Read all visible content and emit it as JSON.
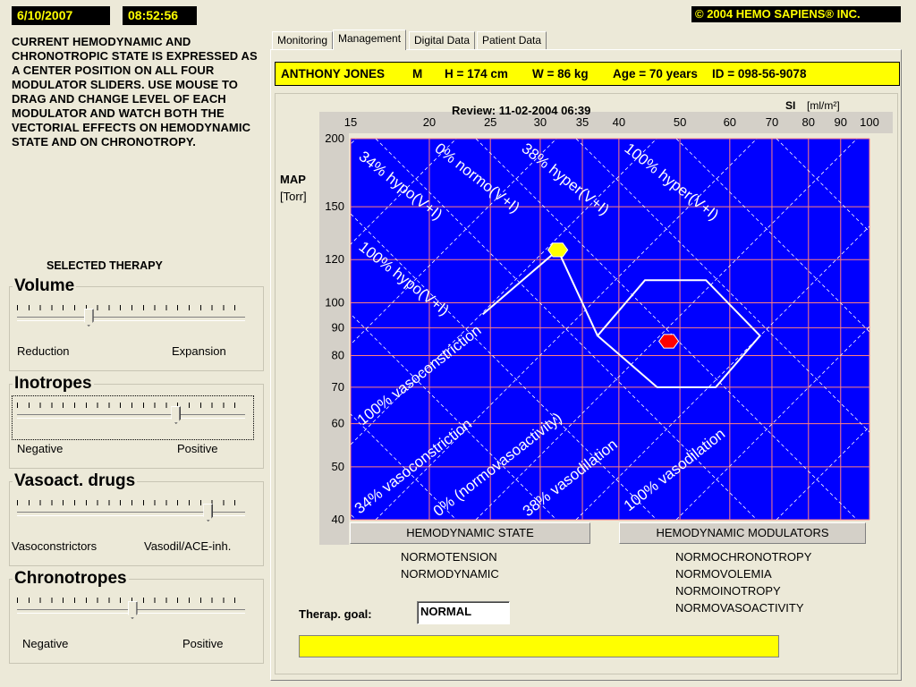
{
  "header": {
    "date": "6/10/2007",
    "time": "08:52:56",
    "copyright": "© 2004 HEMO SAPIENS® INC."
  },
  "description": "CURRENT HEMODYNAMIC AND CHRONOTROPIC STATE IS EXPRESSED AS A CENTER POSITION ON ALL FOUR MODULATOR SLIDERS. USE MOUSE TO DRAG AND CHANGE LEVEL OF EACH MODULATOR AND WATCH BOTH THE VECTORIAL EFFECTS ON HEMODYNAMIC STATE AND ON CHRONOTROPY.",
  "selected_therapy_label": "SELECTED THERAPY",
  "sliders": [
    {
      "title": "Volume",
      "left_label": "Reduction",
      "right_label": "Expansion",
      "value": 0.31
    },
    {
      "title": "Inotropes",
      "left_label": "Negative",
      "right_label": "Positive",
      "value": 0.69
    },
    {
      "title": "Vasoact. drugs",
      "left_label": "Vasoconstrictors",
      "right_label": "Vasodil/ACE-inh.",
      "value": 0.83
    },
    {
      "title": "Chronotropes",
      "left_label": "Negative",
      "right_label": "Positive",
      "value": 0.5
    }
  ],
  "tabs": [
    {
      "label": "Monitoring",
      "active": false
    },
    {
      "label": "Management",
      "active": true
    },
    {
      "label": "Digital Data",
      "active": false
    },
    {
      "label": "Patient Data",
      "active": false
    }
  ],
  "patient": {
    "name": "ANTHONY JONES",
    "sex": "M",
    "height": "H = 174 cm",
    "weight": "W = 86 kg",
    "age": "Age = 70 years",
    "id": "ID = 098-56-9078"
  },
  "chart": {
    "review": "Review: 11-02-2004 06:39",
    "x_axis_label": "SI",
    "x_axis_unit": "[ml/m²]",
    "y_axis_label": "MAP",
    "y_axis_unit": "[Torr]",
    "x_ticks": [
      15,
      20,
      25,
      30,
      35,
      40,
      50,
      60,
      70,
      80,
      90,
      100
    ],
    "y_ticks": [
      40,
      50,
      60,
      70,
      80,
      90,
      100,
      120,
      150,
      200
    ],
    "diagonal_labels": [
      "34% hypo(V+I)",
      "0% normo(V+I)",
      "38% hyper(V+I)",
      "100% hyper(V+I)",
      "100% hypo(V+I)",
      "100% vasoconstriction",
      "34% vasoconstriction",
      "0% (normovasoactivity)",
      "38% vasodilation",
      "100% vasodilation"
    ],
    "colors": {
      "plot_bg": "#0000ff",
      "grid": "#ff8080",
      "current_marker": "#ff0000",
      "goal_marker": "#ffff00"
    }
  },
  "chart_data": {
    "type": "scatter",
    "x_scale": "log",
    "y_scale": "log",
    "xlabel": "SI [ml/m²]",
    "ylabel": "MAP [Torr]",
    "xlim": [
      15,
      100
    ],
    "ylim": [
      40,
      200
    ],
    "series": [
      {
        "name": "",
        "points": [
          [
            48,
            85
          ]
        ],
        "color": "#ff0000"
      },
      {
        "name": "",
        "points": [
          [
            32,
            125
          ]
        ],
        "color": "#ffff00"
      }
    ],
    "normal_zone_polygon": [
      [
        44,
        110
      ],
      [
        55,
        110
      ],
      [
        67,
        87
      ],
      [
        57,
        70
      ],
      [
        46,
        70
      ],
      [
        37,
        87
      ]
    ]
  },
  "buttons": {
    "hemodynamic_state": "HEMODYNAMIC STATE",
    "hemodynamic_modulators": "HEMODYNAMIC MODULATORS"
  },
  "hemodynamic_state_values": [
    "NORMOTENSION",
    "NORMODYNAMIC"
  ],
  "hemodynamic_modulator_values": [
    "NORMOCHRONOTROPY",
    "NORMOVOLEMIA",
    "NORMOINOTROPY",
    "NORMOVASOACTIVITY"
  ],
  "therap_goal": {
    "label": "Therap. goal:",
    "value": "NORMAL"
  }
}
